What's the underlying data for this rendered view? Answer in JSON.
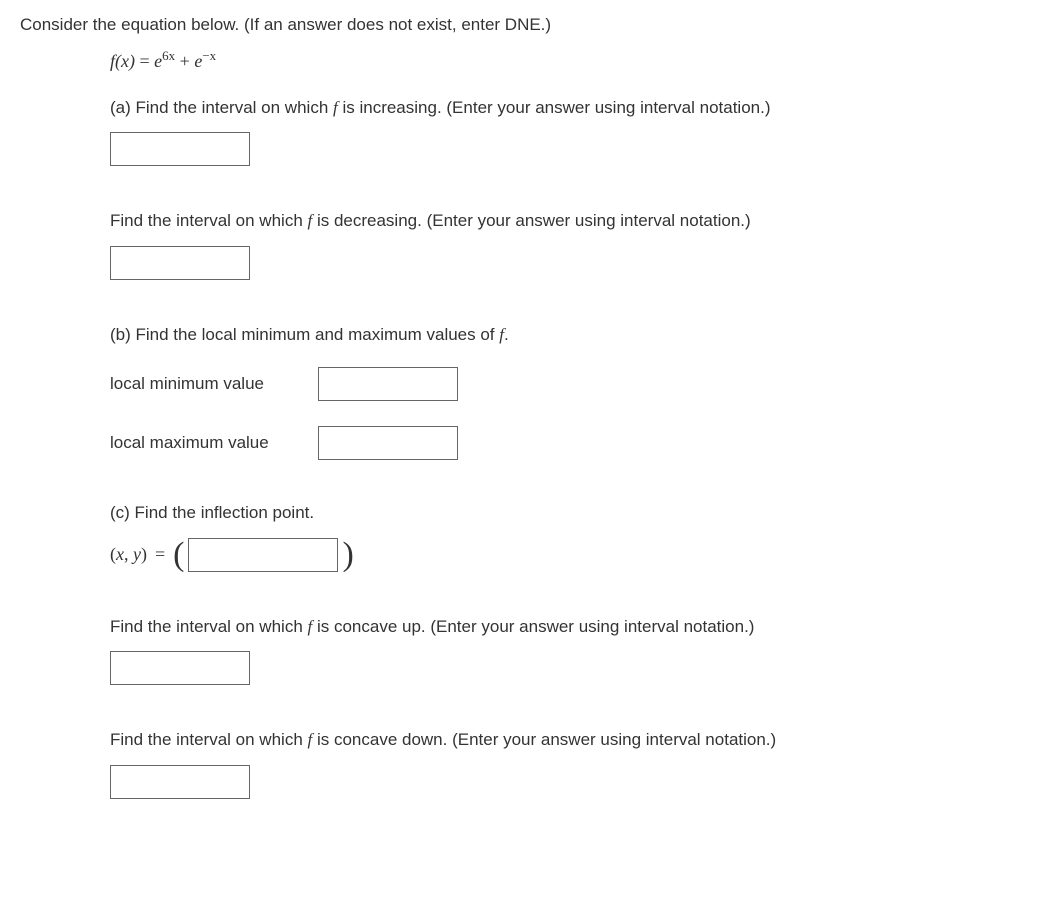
{
  "intro": "Consider the equation below. (If an answer does not exist, enter DNE.)",
  "eq": {
    "fx": "f",
    "x": "x",
    "eq": "=",
    "e1": "e",
    "exp1": "6x",
    "plus": "+",
    "e2": "e",
    "exp2": "−x"
  },
  "a": {
    "prompt1_pre": "(a) Find the interval on which ",
    "prompt1_f": "f",
    "prompt1_post": " is increasing. (Enter your answer using interval notation.)",
    "prompt2_pre": "Find the interval on which ",
    "prompt2_f": "f",
    "prompt2_post": " is decreasing. (Enter your answer using interval notation.)"
  },
  "b": {
    "prompt_pre": "(b) Find the local minimum and maximum values of ",
    "prompt_f": "f",
    "prompt_post": ".",
    "local_min": "local minimum value",
    "local_max": "local maximum value"
  },
  "c": {
    "prompt": "(c) Find the inflection point.",
    "xy_pre": "(",
    "xy_x": "x",
    "xy_comma": ", ",
    "xy_y": "y",
    "xy_post": ")",
    "eq": "=",
    "lparen": "(",
    "rparen": ")",
    "concave_up_pre": "Find the interval on which ",
    "concave_up_f": "f",
    "concave_up_post": " is concave up. (Enter your answer using interval notation.)",
    "concave_down_pre": "Find the interval on which ",
    "concave_down_f": "f",
    "concave_down_post": " is concave down. (Enter your answer using interval notation.)"
  }
}
